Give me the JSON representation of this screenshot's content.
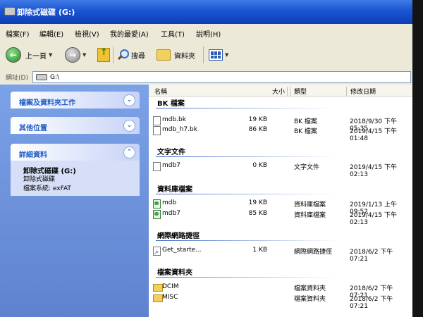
{
  "window": {
    "title": "卸除式磁碟 (G:)"
  },
  "menu": [
    "檔案(F)",
    "編輯(E)",
    "檢視(V)",
    "我的最愛(A)",
    "工具(T)",
    "說明(H)"
  ],
  "toolbar": {
    "back_label": "上一頁",
    "search_label": "搜尋",
    "folders_label": "資料夾"
  },
  "address": {
    "label": "網址(D)",
    "path": "G:\\"
  },
  "tasks": {
    "file_folder_tasks": "檔案及資料夾工作",
    "other_places": "其他位置",
    "details": "詳細資料",
    "details_title": "卸除式磁碟 (G:)",
    "details_type": "卸除式磁碟",
    "details_fs": "檔案系統: exFAT"
  },
  "columns": {
    "name": "名稱",
    "size": "大小",
    "type": "類型",
    "modified": "修改日期"
  },
  "groups": {
    "bk": {
      "label": "BK 檔案",
      "items": [
        {
          "name": "mdb.bk",
          "size": "19 KB",
          "type": "BK 檔案",
          "modified": "2018/9/30 下午 05:35"
        },
        {
          "name": "mdb_h7.bk",
          "size": "86 KB",
          "type": "BK 檔案",
          "modified": "2019/4/15 下午 01:48"
        }
      ]
    },
    "text": {
      "label": "文字文件",
      "items": [
        {
          "name": "mdb7",
          "size": "0 KB",
          "type": "文字文件",
          "modified": "2019/4/15 下午 02:13"
        }
      ]
    },
    "db": {
      "label": "資料庫檔案",
      "items": [
        {
          "name": "mdb",
          "size": "19 KB",
          "type": "資料庫檔案",
          "modified": "2019/1/13 上午 09:52"
        },
        {
          "name": "mdb7",
          "size": "85 KB",
          "type": "資料庫檔案",
          "modified": "2019/4/15 下午 02:13"
        }
      ]
    },
    "shortcut": {
      "label": "網際網路捷徑",
      "items": [
        {
          "name": "Get_starte...",
          "size": "1 KB",
          "type": "網際網路捷徑",
          "modified": "2018/6/2 下午 07:21"
        }
      ]
    },
    "folders": {
      "label": "檔案資料夾",
      "items": [
        {
          "name": "DCIM",
          "size": "",
          "type": "檔案資料夾",
          "modified": "2018/6/2 下午 07:21"
        },
        {
          "name": "MISC",
          "size": "",
          "type": "檔案資料夾",
          "modified": "2018/6/2 下午 07:21"
        }
      ]
    }
  },
  "colors": {
    "title_bar": "#1b54d1",
    "task_pane": "#6a8fd8",
    "group_line": "#3e6bc8"
  },
  "icons": [
    "back-icon",
    "forward-icon",
    "up-folder-icon",
    "search-icon",
    "folders-icon",
    "views-icon",
    "drive-icon",
    "chevron-icon",
    "file-icon",
    "database-icon",
    "shortcut-icon",
    "folder-icon"
  ]
}
